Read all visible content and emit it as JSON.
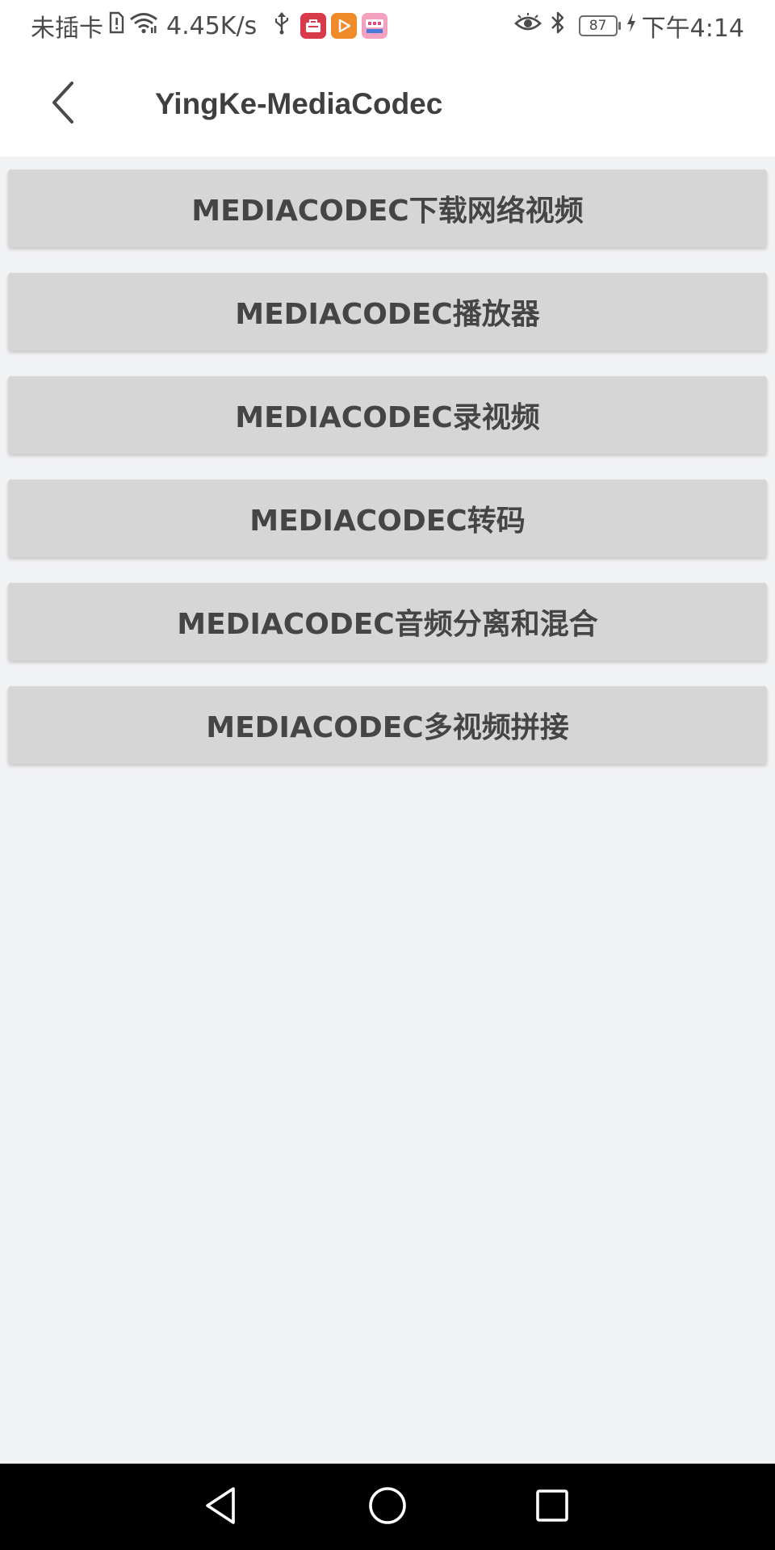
{
  "status_bar": {
    "carrier": "未插卡",
    "speed": "4.45K/s",
    "battery": "87",
    "time": "下午4:14",
    "icons": [
      "sim-alert-icon",
      "wifi-icon",
      "usb-icon",
      "app-shop-icon",
      "app-video-icon",
      "bilibili-icon",
      "eye-icon",
      "bluetooth-icon",
      "battery-icon",
      "charging-icon"
    ]
  },
  "toolbar": {
    "title": "YingKe-MediaCodec",
    "back_icon": "chevron-left-icon"
  },
  "menu": {
    "items": [
      {
        "label": "MEDIACODEC下载网络视频"
      },
      {
        "label": "MEDIACODEC播放器"
      },
      {
        "label": "MEDIACODEC录视频"
      },
      {
        "label": "MEDIACODEC转码"
      },
      {
        "label": "MEDIACODEC音频分离和混合"
      },
      {
        "label": "MEDIACODEC多视频拼接"
      }
    ]
  },
  "nav_bar": {
    "icons": [
      "back-triangle-icon",
      "home-circle-icon",
      "recents-square-icon"
    ]
  },
  "colors": {
    "background": "#f1f2f4",
    "button": "#d6d6d6",
    "button_text": "#454545",
    "title_text": "#3f3f3f",
    "nav_bar": "#000000"
  }
}
